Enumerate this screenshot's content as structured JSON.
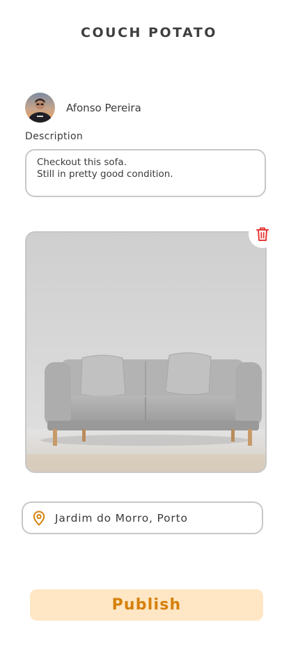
{
  "header": {
    "title": "COUCH POTATO"
  },
  "author": {
    "name": "Afonso Pereira"
  },
  "description": {
    "label": "Description",
    "lines": [
      "Checkout this sofa.",
      "Still in pretty good condition."
    ]
  },
  "photo": {
    "delete_icon": "trash-icon"
  },
  "location": {
    "icon": "map-pin-icon",
    "value": "Jardim do Morro, Porto"
  },
  "actions": {
    "publish_label": "Publish"
  },
  "colors": {
    "accent": "#d5800a",
    "publish_bg": "#ffe6c4",
    "delete": "#e53935",
    "border": "#c7c7c7"
  }
}
